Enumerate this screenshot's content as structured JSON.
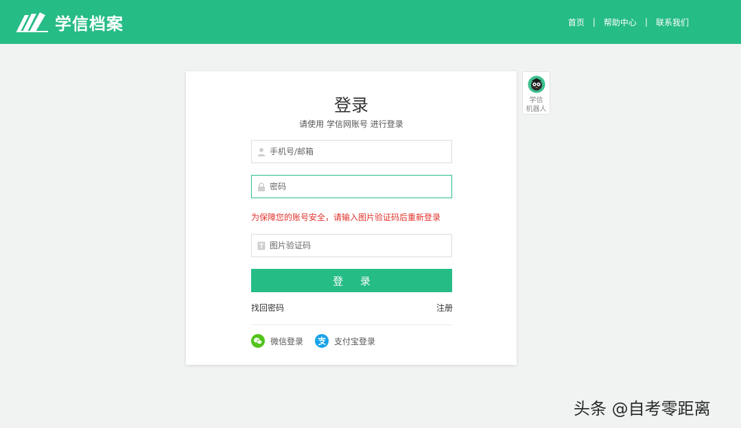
{
  "header": {
    "logo_text": "学信档案",
    "nav": [
      {
        "label": "首页"
      },
      {
        "label": "帮助中心"
      },
      {
        "label": "联系我们"
      }
    ],
    "separator": "|"
  },
  "login": {
    "title": "登录",
    "subtitle": "请使用 学信网账号 进行登录",
    "username_placeholder": "手机号/邮箱",
    "password_placeholder": "密码",
    "warning": "为保障您的账号安全，请输入图片验证码后重新登录",
    "captcha_placeholder": "图片验证码",
    "submit_label": "登 录",
    "forgot_label": "找回密码",
    "register_label": "注册",
    "wechat_label": "微信登录",
    "alipay_label": "支付宝登录"
  },
  "robot": {
    "line1": "学信",
    "line2": "机器人"
  },
  "watermark": "头条 @自考零距离",
  "colors": {
    "brand": "#26bc86",
    "warning": "#e0312b",
    "wechat": "#52c41a",
    "alipay": "#1aa3e8"
  }
}
